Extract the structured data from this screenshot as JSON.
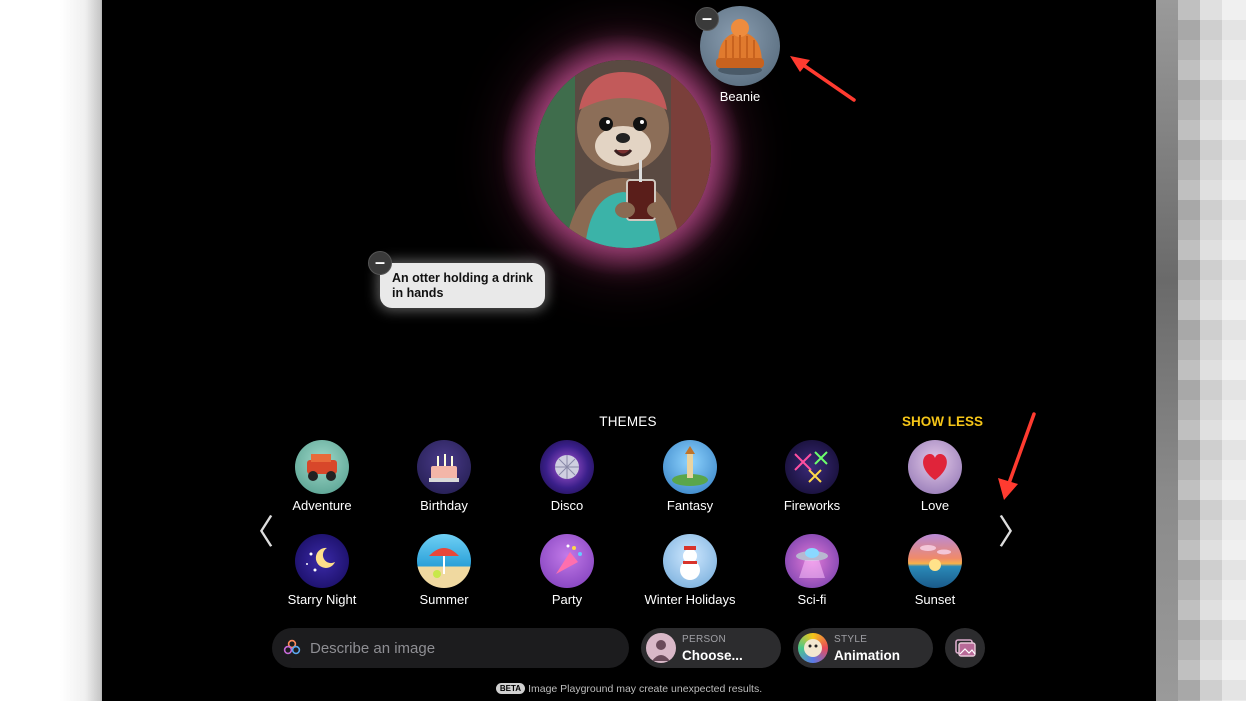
{
  "canvas": {
    "concepts": [
      {
        "label": "Beanie",
        "icon": "beanie-icon"
      },
      {
        "label": "An otter holding a drink in hands"
      }
    ],
    "main_image": "otter-image",
    "remove_glyph": "–"
  },
  "themes": {
    "title": "THEMES",
    "toggle_label": "SHOW LESS",
    "items": [
      {
        "label": "Adventure"
      },
      {
        "label": "Birthday"
      },
      {
        "label": "Disco"
      },
      {
        "label": "Fantasy"
      },
      {
        "label": "Fireworks"
      },
      {
        "label": "Love"
      },
      {
        "label": "Starry Night"
      },
      {
        "label": "Summer"
      },
      {
        "label": "Party"
      },
      {
        "label": "Winter Holidays"
      },
      {
        "label": "Sci-fi"
      },
      {
        "label": "Sunset"
      }
    ],
    "prev_glyph": "〈",
    "next_glyph": "〉"
  },
  "bottom_bar": {
    "describe_placeholder": "Describe an image",
    "person": {
      "caption": "PERSON",
      "value": "Choose..."
    },
    "style": {
      "caption": "STYLE",
      "value": "Animation"
    }
  },
  "footer": {
    "badge": "BETA",
    "text": "Image Playground may create unexpected results."
  },
  "colors": {
    "accent_yellow": "#f5c518",
    "annotation_arrow": "#ff3b30",
    "background": "#000000"
  }
}
